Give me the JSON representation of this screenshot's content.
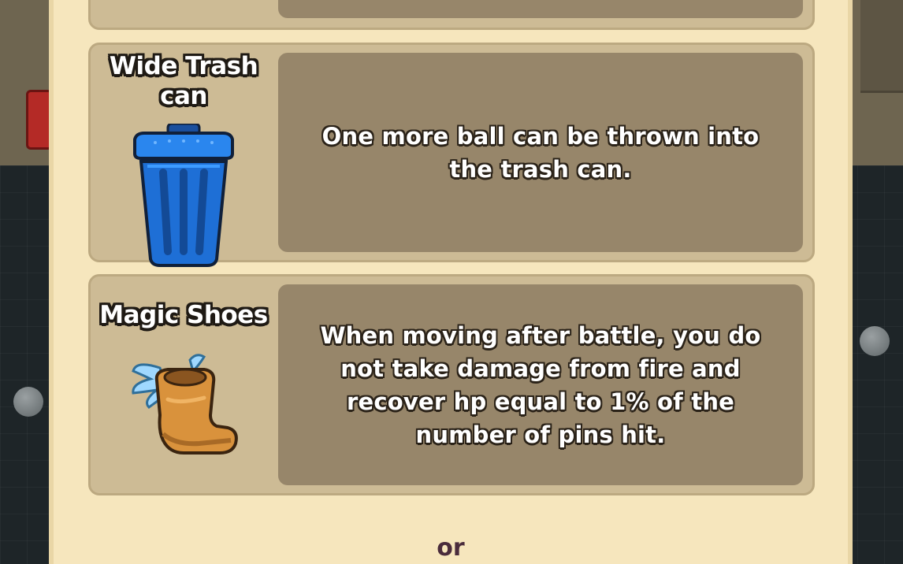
{
  "rewards": [
    {
      "name": "Wide Trash can",
      "description": "One more ball can be thrown into the trash can.",
      "icon": "trash-can-icon"
    },
    {
      "name": "Magic Shoes",
      "description": "When moving after battle, you do not take damage from fire and recover hp equal to 1% of the number of pins hit.",
      "icon": "winged-boot-icon"
    }
  ],
  "separator": "or",
  "colors": {
    "panel": "#f6e6bd",
    "card": "#cdbb95",
    "description_box": "#97866a",
    "trash_can": "#1e6fd6",
    "boot": "#d9923c",
    "wing": "#9fd8ff"
  }
}
